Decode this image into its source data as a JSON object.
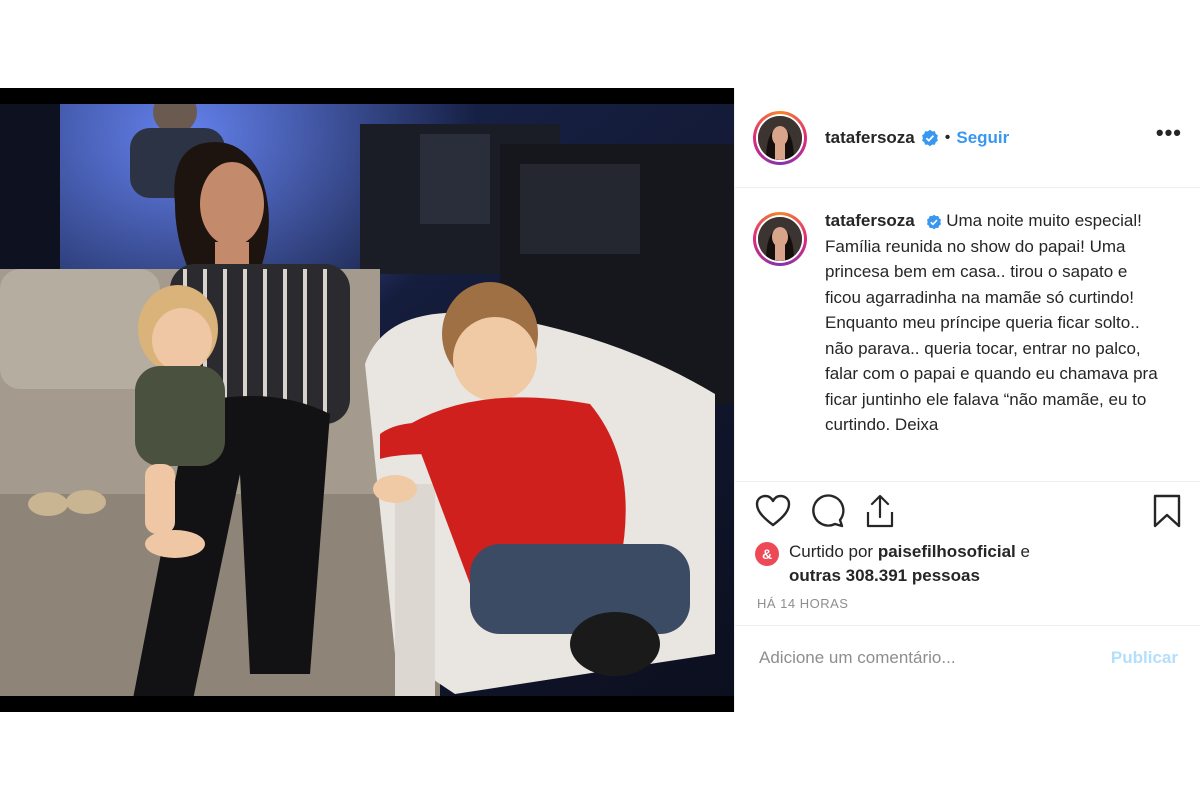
{
  "post": {
    "photo": {
      "alt": ""
    },
    "author": {
      "username": "tatafersoza",
      "verified": true,
      "separator": "•",
      "follow_label": "Seguir",
      "more_label": "•••"
    },
    "caption": {
      "username": "tatafersoza",
      "text": "Uma noite muito especial! Família reunida no show do papai! Uma princesa bem em casa.. tirou o sapato e ficou agarradinha na mamãe só curtindo! Enquanto meu príncipe queria ficar solto.. não parava.. queria tocar, entrar no palco, falar com o papai e quando eu chamava pra ficar juntinho ele falava “não mamãe, eu to curtindo. Deixa"
    },
    "actions": {
      "icons": [
        "heart-icon",
        "comment-icon",
        "share-icon",
        "bookmark-icon"
      ]
    },
    "likes": {
      "prefix": "Curtido por",
      "user": "paisefilhosoficial",
      "conjunction": "e",
      "others": "outras 308.391 pessoas"
    },
    "timestamp": "HÁ 14 HORAS",
    "comment": {
      "placeholder": "Adicione um comentário...",
      "publish_label": "Publicar"
    },
    "colors": {
      "accent": "#3897f0",
      "publish_disabled": "#b2dffc",
      "like_badge": "#ed4956",
      "muted": "#8e8e8e"
    }
  }
}
